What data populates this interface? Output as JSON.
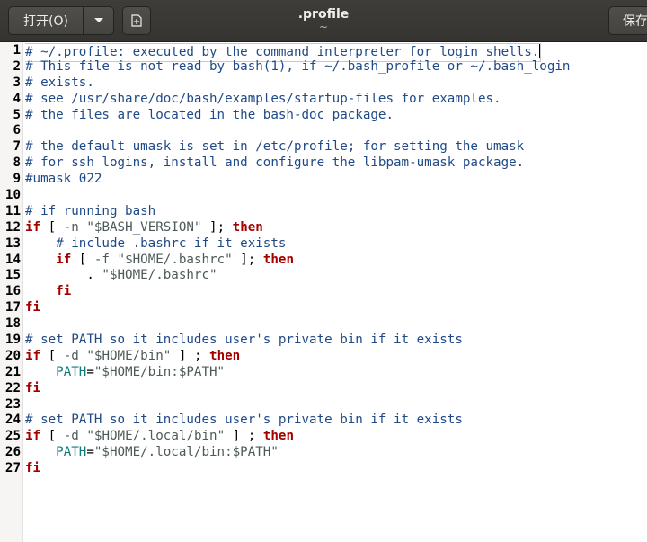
{
  "header": {
    "open_label": "打开(O)",
    "title": ".profile",
    "subtitle": "~",
    "save_label": "保存"
  },
  "editor": {
    "lines": [
      [
        {
          "t": "# ~/.profile: executed by the command interpreter for login shells.",
          "c": "cm"
        }
      ],
      [
        {
          "t": "# This file is not read by bash(1), if ~/.bash_profile or ~/.bash_login",
          "c": "cm"
        }
      ],
      [
        {
          "t": "# exists.",
          "c": "cm"
        }
      ],
      [
        {
          "t": "# see /usr/share/doc/bash/examples/startup-files for examples.",
          "c": "cm"
        }
      ],
      [
        {
          "t": "# the files are located in the bash-doc package.",
          "c": "cm"
        }
      ],
      [],
      [
        {
          "t": "# the default umask is set in /etc/profile; for setting the umask",
          "c": "cm"
        }
      ],
      [
        {
          "t": "# for ssh logins, install and configure the libpam-umask package.",
          "c": "cm"
        }
      ],
      [
        {
          "t": "#umask 022",
          "c": "cm"
        }
      ],
      [],
      [
        {
          "t": "# if running bash",
          "c": "cm"
        }
      ],
      [
        {
          "t": "if",
          "c": "kw"
        },
        {
          "t": " [ ",
          "c": ""
        },
        {
          "t": "-n",
          "c": "st"
        },
        {
          "t": " ",
          "c": ""
        },
        {
          "t": "\"$BASH_VERSION\"",
          "c": "st"
        },
        {
          "t": " ]; ",
          "c": ""
        },
        {
          "t": "then",
          "c": "kw"
        }
      ],
      [
        {
          "t": "    # include .bashrc if it exists",
          "c": "cm"
        }
      ],
      [
        {
          "t": "    ",
          "c": ""
        },
        {
          "t": "if",
          "c": "kw"
        },
        {
          "t": " [ ",
          "c": ""
        },
        {
          "t": "-f",
          "c": "st"
        },
        {
          "t": " ",
          "c": ""
        },
        {
          "t": "\"$HOME/.bashrc\"",
          "c": "st"
        },
        {
          "t": " ]; ",
          "c": ""
        },
        {
          "t": "then",
          "c": "kw"
        }
      ],
      [
        {
          "t": "        . ",
          "c": ""
        },
        {
          "t": "\"$HOME/.bashrc\"",
          "c": "st"
        }
      ],
      [
        {
          "t": "    ",
          "c": ""
        },
        {
          "t": "fi",
          "c": "kw"
        }
      ],
      [
        {
          "t": "fi",
          "c": "kw"
        }
      ],
      [],
      [
        {
          "t": "# set PATH so it includes user's private bin if it exists",
          "c": "cm"
        }
      ],
      [
        {
          "t": "if",
          "c": "kw"
        },
        {
          "t": " [ ",
          "c": ""
        },
        {
          "t": "-d",
          "c": "st"
        },
        {
          "t": " ",
          "c": ""
        },
        {
          "t": "\"$HOME/bin\"",
          "c": "st"
        },
        {
          "t": " ] ; ",
          "c": ""
        },
        {
          "t": "then",
          "c": "kw"
        }
      ],
      [
        {
          "t": "    ",
          "c": ""
        },
        {
          "t": "PATH",
          "c": "vr"
        },
        {
          "t": "=",
          "c": ""
        },
        {
          "t": "\"$HOME/bin:$PATH\"",
          "c": "st"
        }
      ],
      [
        {
          "t": "fi",
          "c": "kw"
        }
      ],
      [],
      [
        {
          "t": "# set PATH so it includes user's private bin if it exists",
          "c": "cm"
        }
      ],
      [
        {
          "t": "if",
          "c": "kw"
        },
        {
          "t": " [ ",
          "c": ""
        },
        {
          "t": "-d",
          "c": "st"
        },
        {
          "t": " ",
          "c": ""
        },
        {
          "t": "\"$HOME/.local/bin\"",
          "c": "st"
        },
        {
          "t": " ] ; ",
          "c": ""
        },
        {
          "t": "then",
          "c": "kw"
        }
      ],
      [
        {
          "t": "    ",
          "c": ""
        },
        {
          "t": "PATH",
          "c": "vr"
        },
        {
          "t": "=",
          "c": ""
        },
        {
          "t": "\"$HOME/.local/bin:$PATH\"",
          "c": "st"
        }
      ],
      [
        {
          "t": "fi",
          "c": "kw"
        }
      ]
    ]
  }
}
